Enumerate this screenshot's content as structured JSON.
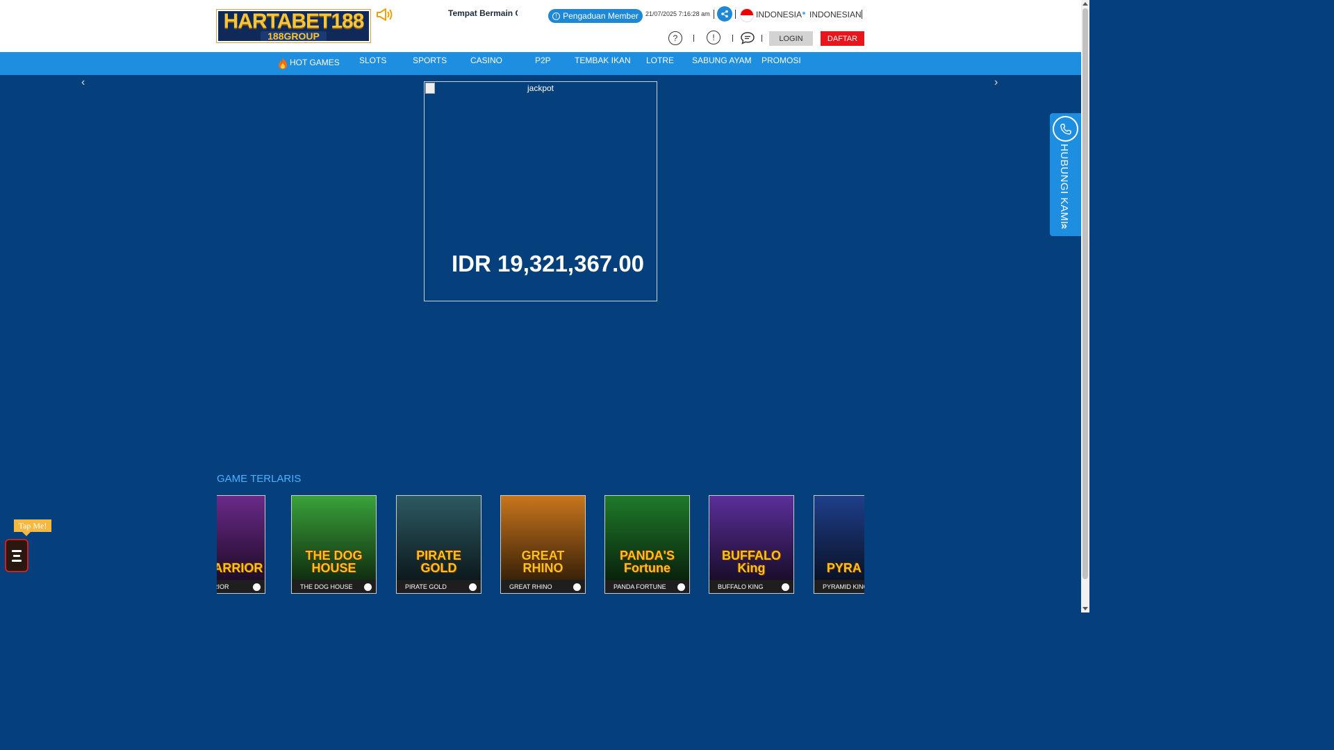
{
  "header": {
    "logo_main": "HARTABET188",
    "logo_sub": "188GROUP",
    "marquee": "Tempat Bermain G",
    "complaint_label": "Pengaduan Member",
    "datetime": "21/07/2025 7:16:28 am",
    "country": "INDONESIA",
    "language": "INDONESIAN",
    "login_label": "LOGIN",
    "register_label": "DAFTAR",
    "help_icon": "?",
    "info_icon": "!"
  },
  "nav": {
    "items": [
      "HOT GAMES",
      "SLOTS",
      "SPORTS",
      "CASINO",
      "P2P",
      "TEMBAK IKAN",
      "LOTRE",
      "SABUNG AYAM",
      "PROMOSI"
    ]
  },
  "banner": {
    "image_alt": "jackpot",
    "amount": "IDR 19,321,367.00"
  },
  "contact": {
    "label": "HUBUNGI KAMI"
  },
  "section": {
    "title": "GAME TERLARIS",
    "games": [
      {
        "name": "EY WARRIOR",
        "art": "EY WARRIOR",
        "bg": "#6a2a8a"
      },
      {
        "name": "THE DOG HOUSE",
        "art": "THE DOG HOUSE",
        "bg": "#3aa23a"
      },
      {
        "name": "PIRATE GOLD",
        "art": "PIRATE GOLD",
        "bg": "#2c5a63"
      },
      {
        "name": "GREAT RHINO",
        "art": "GREAT RHINO",
        "bg": "#c9761c"
      },
      {
        "name": "PANDA FORTUNE",
        "art": "PANDA'S Fortune",
        "bg": "#1f7a2a"
      },
      {
        "name": "BUFFALO KING",
        "art": "BUFFALO King",
        "bg": "#5b2f9a"
      },
      {
        "name": "PYRAMID KING",
        "art": "PYRA KIN",
        "bg": "#1f3f8a"
      }
    ]
  },
  "widgets": {
    "tapme": "Tap Me!"
  },
  "colors": {
    "background": "#053f7c",
    "nav": "#1e8ee0",
    "accent_red": "#e8151b",
    "section_title": "#4ab3ff"
  }
}
